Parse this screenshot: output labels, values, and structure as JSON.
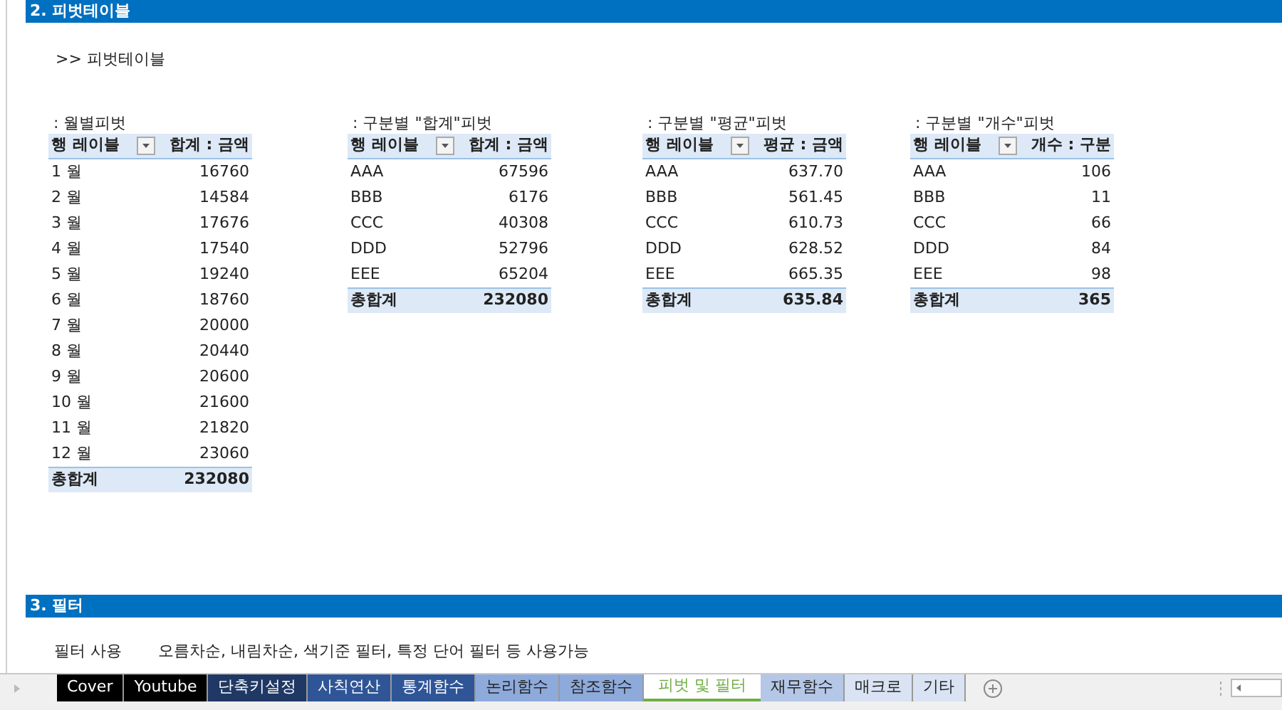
{
  "sections": [
    {
      "title": "2. 피벗테이블"
    },
    {
      "title": "3. 필터"
    }
  ],
  "intro": ">> 피벗테이블",
  "pivots": [
    {
      "caption": " : 월별피벗",
      "row_header": "행 레이블",
      "value_header": "합계 : 금액",
      "rows": [
        [
          "1 월",
          "16760"
        ],
        [
          "2 월",
          "14584"
        ],
        [
          "3 월",
          "17676"
        ],
        [
          "4 월",
          "17540"
        ],
        [
          "5 월",
          "19240"
        ],
        [
          "6 월",
          "18760"
        ],
        [
          "7 월",
          "20000"
        ],
        [
          "8 월",
          "20440"
        ],
        [
          "9 월",
          "20600"
        ],
        [
          "10 월",
          "21600"
        ],
        [
          "11 월",
          "21820"
        ],
        [
          "12 월",
          "23060"
        ]
      ],
      "total_label": "총합계",
      "total": "232080"
    },
    {
      "caption": " : 구분별 \"합계\"피벗",
      "row_header": "행 레이블",
      "value_header": "합계 : 금액",
      "rows": [
        [
          "AAA",
          "67596"
        ],
        [
          "BBB",
          "6176"
        ],
        [
          "CCC",
          "40308"
        ],
        [
          "DDD",
          "52796"
        ],
        [
          "EEE",
          "65204"
        ]
      ],
      "total_label": "총합계",
      "total": "232080"
    },
    {
      "caption": " : 구분별 \"평균\"피벗",
      "row_header": "행 레이블",
      "value_header": "평균 : 금액",
      "rows": [
        [
          "AAA",
          "637.70"
        ],
        [
          "BBB",
          "561.45"
        ],
        [
          "CCC",
          "610.73"
        ],
        [
          "DDD",
          "628.52"
        ],
        [
          "EEE",
          "665.35"
        ]
      ],
      "total_label": "총합계",
      "total": "635.84"
    },
    {
      "caption": " : 구분별 \"개수\"피벗",
      "row_header": "행 레이블",
      "value_header": "개수 : 구분",
      "rows": [
        [
          "AAA",
          "106"
        ],
        [
          "BBB",
          "11"
        ],
        [
          "CCC",
          "66"
        ],
        [
          "DDD",
          "84"
        ],
        [
          "EEE",
          "98"
        ]
      ],
      "total_label": "총합계",
      "total": "365"
    }
  ],
  "filter_row": {
    "label": "필터 사용",
    "text": "오름차순, 내림차순, 색기준 필터, 특정 단어 필터 등 사용가능"
  },
  "sheet_tabs": [
    {
      "label": "Cover",
      "color": "#000000",
      "selected": false
    },
    {
      "label": "Youtube",
      "color": "#000000",
      "selected": false
    },
    {
      "label": "단축키설정",
      "color": "#1f3864",
      "selected": false
    },
    {
      "label": "사칙연산",
      "color": "#2f5597",
      "selected": false
    },
    {
      "label": "통계함수",
      "color": "#2f5597",
      "selected": false
    },
    {
      "label": "논리함수",
      "color": "#8eaadb",
      "selected": false
    },
    {
      "label": "참조함수",
      "color": "#8eaadb",
      "selected": false
    },
    {
      "label": "피벗 및 필터",
      "color": "#70ad47",
      "selected": true
    },
    {
      "label": "재무함수",
      "color": "#b4c7e7",
      "selected": false
    },
    {
      "label": "매크로",
      "color": "#dae3f3",
      "selected": false
    },
    {
      "label": "기타",
      "color": "#dae3f3",
      "selected": false
    }
  ]
}
